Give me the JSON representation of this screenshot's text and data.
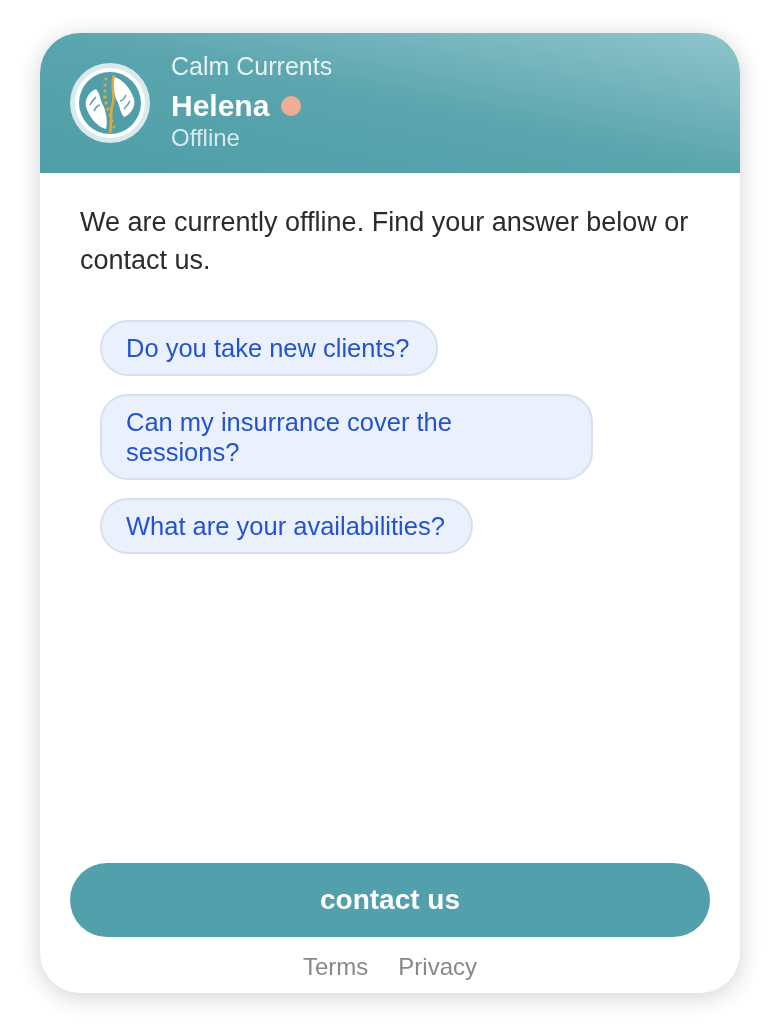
{
  "header": {
    "company": "Calm Currents",
    "agent_name": "Helena",
    "online": false,
    "status": "Offline"
  },
  "message": "We are currently offline. Find your answer below or contact us.",
  "quick_replies": [
    "Do you take new clients?",
    "Can my insurrance cover the sessions?",
    "What are your availabilities?"
  ],
  "contact_button": "contact us",
  "footer_links": [
    "Terms",
    "Privacy"
  ]
}
